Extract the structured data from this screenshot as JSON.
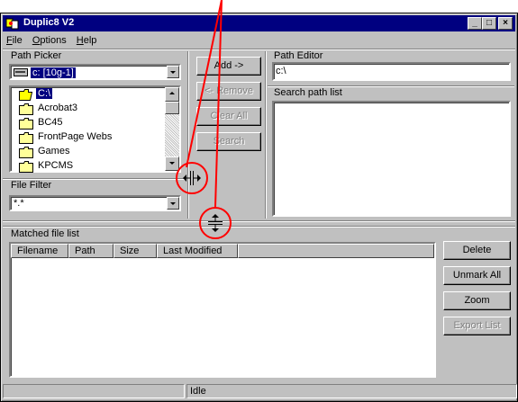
{
  "window": {
    "title": "Duplic8 V2"
  },
  "titlebar_buttons": {
    "minimize": "_",
    "maximize": "□",
    "close": "×"
  },
  "menu": [
    {
      "label": "File",
      "accel": "F",
      "rest": "ile"
    },
    {
      "label": "Options",
      "accel": "O",
      "rest": "ptions"
    },
    {
      "label": "Help",
      "accel": "H",
      "rest": "elp"
    }
  ],
  "path_picker": {
    "label": "Path Picker",
    "drive": "c: [10g-1]",
    "folders": [
      "C:\\",
      "Acrobat3",
      "BC45",
      "FrontPage Webs",
      "Games",
      "KPCMS"
    ]
  },
  "file_filter": {
    "label": "File Filter",
    "value": "*.*"
  },
  "actions": {
    "add": "Add ->",
    "remove": "<- Remove",
    "clear_all": "Clear All",
    "search": "Search"
  },
  "path_editor": {
    "label": "Path Editor",
    "value": "c:\\"
  },
  "search_path_list": {
    "label": "Search path list"
  },
  "matched": {
    "label": "Matched file list",
    "columns": [
      "Filename",
      "Path",
      "Size",
      "Last Modified"
    ]
  },
  "side_buttons": {
    "delete": "Delete",
    "unmark_all": "Unmark All",
    "zoom": "Zoom",
    "export_list": "Export List"
  },
  "status": {
    "text": "Idle"
  },
  "colors": {
    "annotation": "#ff0000",
    "titlebar": "#000080",
    "face": "#c0c0c0"
  }
}
